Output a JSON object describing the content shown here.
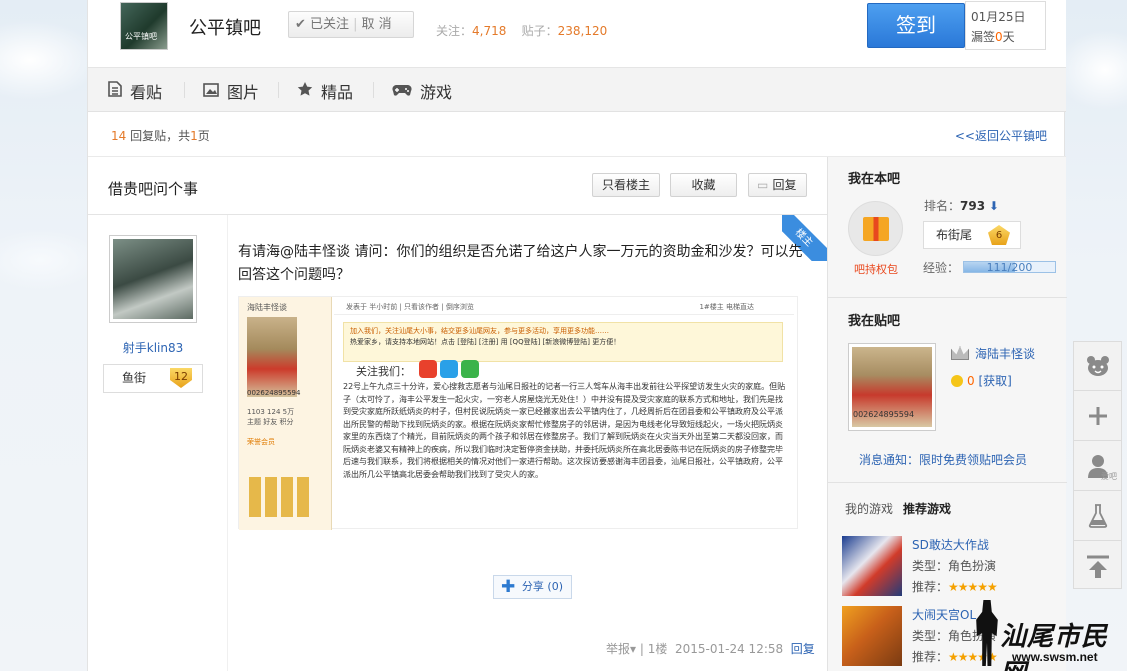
{
  "forum": {
    "name": "公平镇吧",
    "logo_text": "公平镇吧",
    "follow_label": "已关注",
    "unfollow_label": "取 消",
    "follow_count_label": "关注：",
    "follow_count": "4,718",
    "post_count_label": "贴子：",
    "post_count": "238,120"
  },
  "signin": {
    "button": "签到",
    "date": "01月25日",
    "missed_prefix": "漏签",
    "missed_days": "0",
    "missed_suffix": "天"
  },
  "nav": {
    "items": [
      {
        "label": "看贴",
        "icon": "document-icon"
      },
      {
        "label": "图片",
        "icon": "image-icon"
      },
      {
        "label": "精品",
        "icon": "star-icon"
      },
      {
        "label": "游戏",
        "icon": "gamepad-icon"
      }
    ]
  },
  "pager": {
    "reply_count": "14",
    "reply_text": "回复贴，共",
    "page_count": "1",
    "page_text": "页",
    "back_link": "<<返回公平镇吧"
  },
  "thread": {
    "title": "借贵吧问个事",
    "only_op": "只看楼主",
    "favorite": "收藏",
    "reply": "回复",
    "op_badge": "楼主"
  },
  "post": {
    "author": "射手klin83",
    "level_name": "鱼街",
    "level": "12",
    "text": "有请海@陆丰怪谈 请问：你们的组织是否允诺了给这户人家一万元的资助金和沙发？可以先回答这个问题吗？",
    "share_label": "分享",
    "share_count": "(0)",
    "report": "举报",
    "floor": "1楼",
    "time": "2015-01-24 12:58",
    "reply": "回复",
    "image": {
      "title": "海陆丰怪谈",
      "id": "002624895594",
      "stats": "1103  124  5万",
      "stats_labels": "主题  好友  积分",
      "vip": "荣誉会员",
      "top_bar": "发表于 半小时前 | 只看该作者 | 倒序浏览",
      "top_right": "1#楼主  电梯直达",
      "notice1": "加入我们，关注汕尾大小事，结交更多汕尾网友，参与更多活动，享用更多功能……",
      "notice2": "热爱家乡，请支持本地网站！点击 [登陆] [注册] 用 [QQ登陆] [新浪微博登陆] 更方便！",
      "follow": "关注我们：",
      "body": "22号上午九点三十分许，爱心搜救志愿者与汕尾日报社的记者一行三人驾车从海丰出发前往公平探望访发生火灾的家庭。但贴子（太可怜了，海丰公平发生一起火灾，一穷老人房屋烧光无处住！）中并没有提及受灾家庭的联系方式和地址，我们先是找到受灾家庭所跃纸炳炎的村子，但村民说阮炳炎一家已经搬家出去公平镇内住了，几经周折后在团县委和公平镇政府及公平派出所民警的帮助下找到阮炳炎的家。根据在阮炳炎家帮忙修整房子的邻居讲，是因为电线老化导致短线起火，一场火把阮炳炎家里的东西烧了个精光，目前阮炳炎的两个孩子和邻居在修整房子。我们了解到阮炳炎在火灾当天外出至第二天都没回家，而阮炳炎老婆又有精神上的疾病，所以我们临时决定暂停资金扶助，并委托阮炳炎所在高北居委陈书记在阮炳炎的房子修整完毕后速与我们联系，我们将根据相关的情况对他们一家进行帮助。这次探访要感谢海丰团县委，汕尾日报社，公平镇政府，公平派出所几公平镇高北居委会帮助我们找到了受灾人的家。"
    }
  },
  "sidebar": {
    "my_in_bar": "我在本吧",
    "gift_label": "吧持权包",
    "rank_label": "排名：",
    "rank": "793",
    "rank_arrow": "⬇",
    "title": "布街尾",
    "title_level": "6",
    "exp_label": "经验：",
    "exp_text": "111/200",
    "exp_fraction": 0.555,
    "my_bars": "我在贴吧",
    "bar_name": "海陆丰怪谈",
    "bar_image_id": "002624895594",
    "coins": "0",
    "coin_link": "[获取]",
    "notice": "消息通知：限时免费领贴吧会员",
    "games_tab": "我的游戏",
    "recommend_tab": "推荐游戏",
    "games": [
      {
        "name": "SD敢达大作战",
        "type_label": "类型：",
        "type": "角色扮演",
        "rec_label": "推荐：",
        "stars": "★★★★★"
      },
      {
        "name": "大闹天宫OL",
        "type_label": "类型：",
        "type": "角色扮演",
        "rec_label": "推荐：",
        "stars": "★★★★★"
      }
    ]
  },
  "toolbar": {
    "face_icon": "bear-face-icon",
    "plus_icon": "plus-icon",
    "user_label": "爱吧",
    "flask_icon": "flask-icon",
    "top_icon": "back-to-top-icon"
  },
  "watermark": {
    "text": "汕尾市民网",
    "url": "www.swsm.net"
  }
}
